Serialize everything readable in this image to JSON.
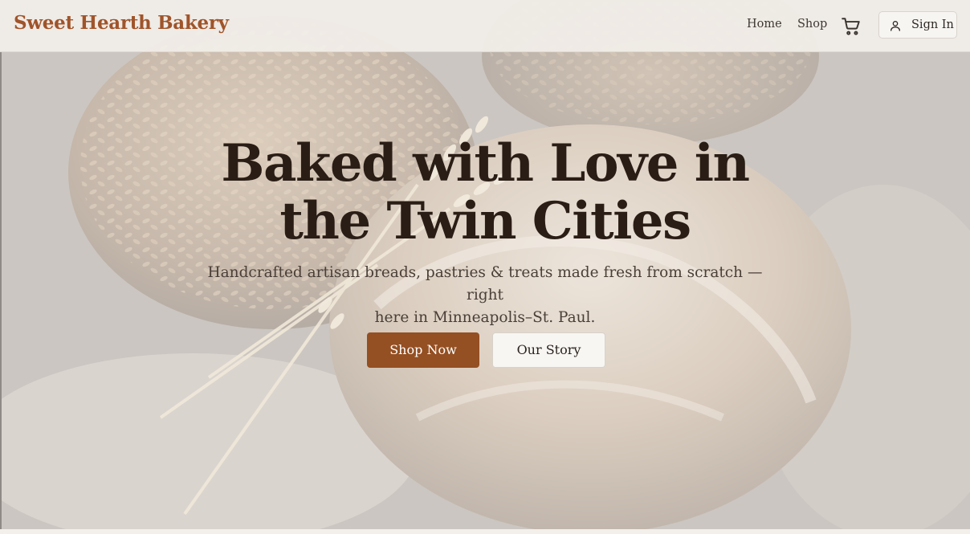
{
  "header": {
    "brand": "Sweet Hearth Bakery",
    "nav": {
      "home": "Home",
      "shop": "Shop"
    },
    "cart_icon": "shopping-cart-icon",
    "signin": {
      "label": "Sign In",
      "icon": "user-icon"
    }
  },
  "hero": {
    "title_line1": "Baked with Love in",
    "title_line2": "the Twin Cities",
    "subtitle_line1": "Handcrafted artisan breads, pastries & treats made fresh from scratch — right",
    "subtitle_line2": "here in Minneapolis–St. Paul.",
    "primary_cta": "Shop Now",
    "secondary_cta": "Our Story",
    "background_image": "artisan-bread-loaves-with-wheat"
  },
  "colors": {
    "brand": "#a0542a",
    "primary_button": "#944f22",
    "title_text": "#2a1d15",
    "body_text": "#4a3f37",
    "header_bg": "#f1eee9"
  }
}
